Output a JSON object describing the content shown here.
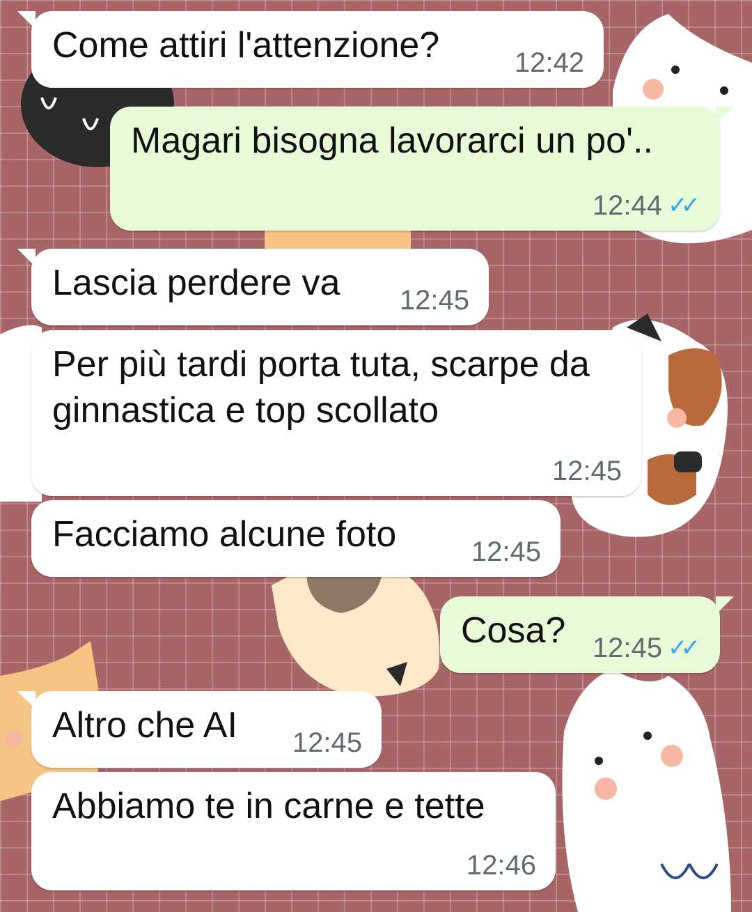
{
  "chat": {
    "messages": [
      {
        "direction": "in",
        "text": "Come attiri l'attenzione?",
        "time": "12:42"
      },
      {
        "direction": "out",
        "text": "Magari bisogna lavorarci un po'..",
        "time": "12:44",
        "status": "read-ticks-icon"
      },
      {
        "direction": "in",
        "text": "Lascia perdere va",
        "time": "12:45"
      },
      {
        "direction": "in",
        "text": "Per più tardi porta tuta, scarpe da ginnastica e top scollato",
        "time": "12:45"
      },
      {
        "direction": "in",
        "text": "Facciamo alcune foto",
        "time": "12:45"
      },
      {
        "direction": "out",
        "text": "Cosa?",
        "time": "12:45",
        "status": "read-ticks-icon"
      },
      {
        "direction": "in",
        "text": "Altro che AI",
        "time": "12:45"
      },
      {
        "direction": "in",
        "text": "Abbiamo te in carne e tette",
        "time": "12:46"
      }
    ]
  },
  "colors": {
    "wallpaper": "#a86567",
    "incoming_bubble": "#ffffff",
    "outgoing_bubble": "#e8fbd8",
    "timestamp": "#5f6a6f",
    "read_ticks": "#35a4e8"
  },
  "ticks_glyph": "✓✓"
}
